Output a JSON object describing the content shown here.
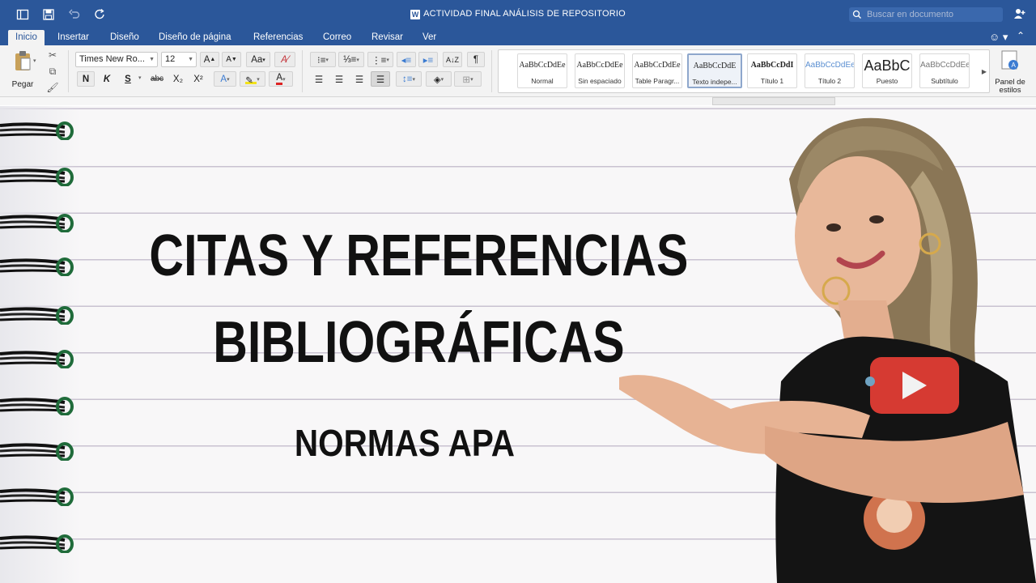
{
  "window": {
    "title": "ACTIVIDAD FINAL ANÁLISIS DE REPOSITORIO",
    "search_placeholder": "Buscar en documento",
    "word_badge": "W"
  },
  "tabs": [
    "Inicio",
    "Insertar",
    "Diseño",
    "Diseño de página",
    "Referencias",
    "Correo",
    "Revisar",
    "Ver"
  ],
  "clipboard": {
    "paste_label": "Pegar"
  },
  "font": {
    "name": "Times New Ro...",
    "size": "12"
  },
  "format_buttons": {
    "grow": "A",
    "shrink": "A",
    "change_case": "Aa",
    "bold": "N",
    "italic": "K",
    "underline": "S",
    "strikethrough": "abc",
    "subscript": "X₂",
    "superscript": "X²",
    "text_effects": "A",
    "font_color": "A"
  },
  "paragraph_buttons": {
    "pilcrow": "¶"
  },
  "styles": [
    {
      "preview": "AaBbCcDdEe",
      "label": "Normal"
    },
    {
      "preview": "AaBbCcDdEe",
      "label": "Sin espaciado"
    },
    {
      "preview": "AaBbCcDdEe",
      "label": "Table Paragr..."
    },
    {
      "preview": "AaBbCcDdE",
      "label": "Texto indepe..."
    },
    {
      "preview": "AaBbCcDdI",
      "label": "Título 1"
    },
    {
      "preview": "AaBbCcDdEe",
      "label": "Título 2"
    },
    {
      "preview": "AaBbC",
      "label": "Puesto"
    },
    {
      "preview": "AaBbCcDdEe",
      "label": "Subtítulo"
    }
  ],
  "styles_pane": {
    "label_line1": "Panel de",
    "label_line2": "estilos"
  },
  "document": {
    "line1": "CITAS Y REFERENCIAS",
    "line2": "BIBLIOGRÁFICAS",
    "subtitle": "NORMAS APA"
  },
  "colors": {
    "word_blue": "#2b579a",
    "ribbon_bg": "#f3f3f3",
    "page_bg": "#f8f7f8",
    "ruled_line": "#c9c2d1",
    "ring_green": "#1f6b3a"
  }
}
